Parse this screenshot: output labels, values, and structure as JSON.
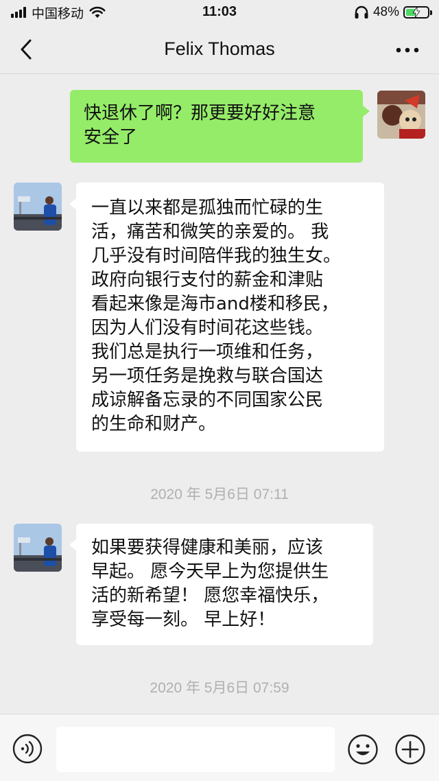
{
  "status_bar": {
    "carrier": "中国移动",
    "time": "11:03",
    "battery_percent": "48%",
    "battery_level": 0.48,
    "icons": [
      "signal-icon",
      "wifi-icon",
      "headphones-icon",
      "battery-charging-icon"
    ]
  },
  "nav": {
    "title": "Felix Thomas",
    "back_icon": "chevron-left-icon",
    "more_icon": "more-dots-icon"
  },
  "messages": [
    {
      "direction": "outgoing",
      "lines": [
        "快退休了啊？那更要好好注意",
        "安全了"
      ]
    },
    {
      "direction": "incoming",
      "lines": [
        "一直以来都是孤独而忙碌的生",
        "活，痛苦和微笑的亲爱的。 我",
        "几乎没有时间陪伴我的独生女。",
        " 政府向银行支付的薪金和津贴",
        "看起来像是海市and楼和移民，",
        "因为人们没有时间花这些钱。",
        "我们总是执行一项维和任务，",
        "另一项任务是挽救与联合国达",
        "成谅解备忘录的不同国家公民",
        "的生命和财产。"
      ]
    },
    {
      "type": "timestamp",
      "text": "2020 年 5月6日 07:11"
    },
    {
      "direction": "incoming",
      "lines": [
        "如果要获得健康和美丽，应该",
        "早起。 愿今天早上为您提供生",
        "活的新希望！ 愿您幸福快乐，",
        "享受每一刻。 早上好！"
      ]
    },
    {
      "type": "timestamp",
      "text": "2020 年 5月6日 07:59"
    }
  ],
  "input_bar": {
    "placeholder": "",
    "icons": [
      "voice-icon",
      "emoji-icon",
      "plus-icon"
    ]
  },
  "colors": {
    "background": "#ededed",
    "outgoing_bubble": "#95ec69",
    "incoming_bubble": "#ffffff",
    "timestamp_text": "#b0b0b0"
  }
}
